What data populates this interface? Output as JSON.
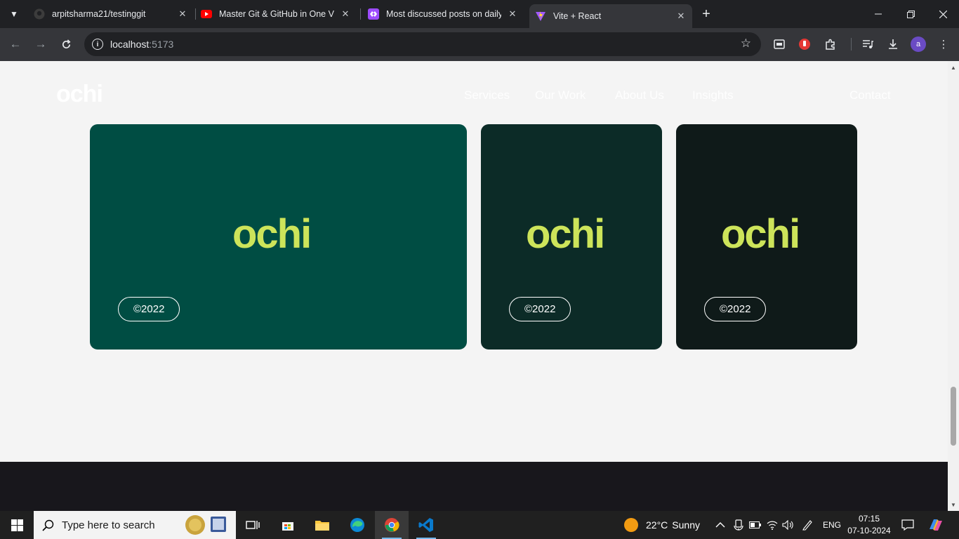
{
  "browser": {
    "tabs": [
      {
        "title": "arpitsharma21/testinggit",
        "icon": "github-icon"
      },
      {
        "title": "Master Git & GitHub in One Vid",
        "icon": "youtube-icon"
      },
      {
        "title": "Most discussed posts on daily.d",
        "icon": "daily-dev-icon"
      },
      {
        "title": "Vite + React",
        "icon": "vite-icon"
      }
    ],
    "active_tab": 3,
    "url_host": "localhost",
    "url_port": ":5173"
  },
  "site": {
    "logo": "ochi",
    "nav": [
      "Services",
      "Our Work",
      "About Us",
      "Insights",
      "Contact"
    ],
    "cards": [
      {
        "logo": "ochi",
        "badge": "©2022",
        "color": "#004d43"
      },
      {
        "logo": "ochi",
        "badge": "©2022",
        "color": "#0c2b27"
      },
      {
        "logo": "ochi",
        "badge": "©2022",
        "color": "#0f1a19"
      }
    ]
  },
  "taskbar": {
    "search_placeholder": "Type here to search",
    "weather": {
      "temp": "22°C",
      "condition": "Sunny"
    },
    "language": "ENG",
    "time": "07:15",
    "date": "07-10-2024"
  },
  "colors": {
    "accent_logo": "#cde45a",
    "page_bg": "#f4f4f4",
    "footer": "#18171c"
  }
}
